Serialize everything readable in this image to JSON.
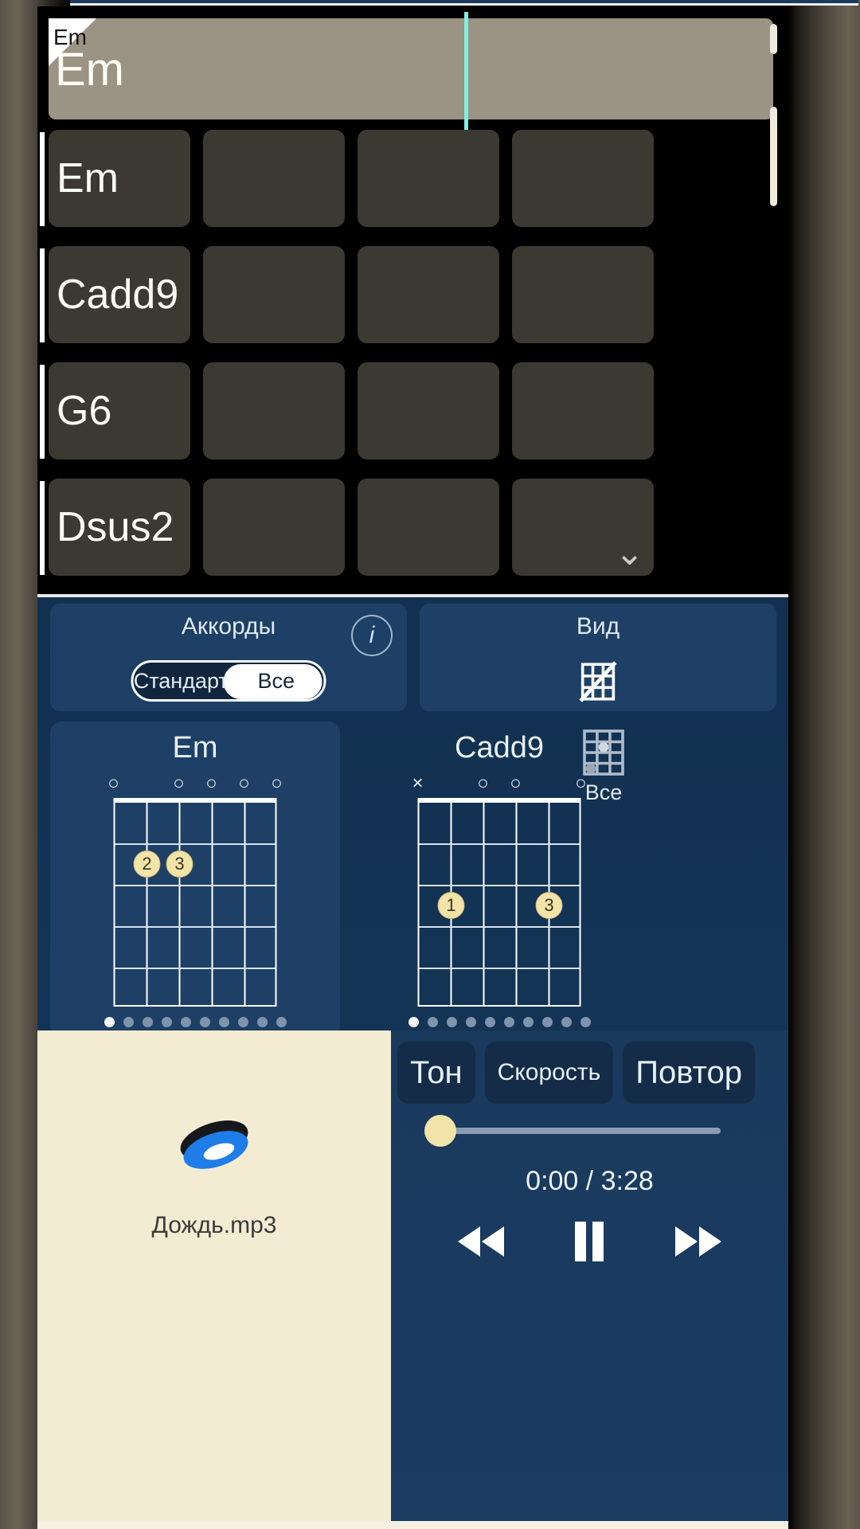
{
  "grid": {
    "timeline": {
      "corner_label": "Em",
      "current_chord": "Em",
      "playhead_label": "playhead"
    },
    "rows": [
      {
        "label": "Em",
        "cells": [
          "Em",
          "",
          "",
          ""
        ]
      },
      {
        "label": "Cadd9",
        "cells": [
          "Cadd9",
          "",
          "",
          ""
        ]
      },
      {
        "label": "G6",
        "cells": [
          "G6",
          "",
          "",
          ""
        ]
      },
      {
        "label": "Dsus2",
        "cells": [
          "Dsus2",
          "",
          "",
          ""
        ]
      }
    ],
    "expand_icon": "chevron-down-icon"
  },
  "options": {
    "chords": {
      "title": "Аккорды",
      "info_label": "i",
      "segments": [
        "Стандарт",
        "Все"
      ],
      "selected": "Все"
    },
    "view": {
      "title": "Вид",
      "icon": "grid-off-icon"
    }
  },
  "diagrams": [
    {
      "name": "Em",
      "markers": [
        "o",
        "",
        "o",
        "o",
        "o",
        ""
      ],
      "string_marks": [
        {
          "string": 1,
          "symbol": "o"
        },
        {
          "string": 3,
          "symbol": "o"
        },
        {
          "string": 4,
          "symbol": "o"
        },
        {
          "string": 5,
          "symbol": "o"
        }
      ],
      "fingers": [
        {
          "string": 2,
          "fret": 2,
          "finger": "2"
        },
        {
          "string": 3,
          "fret": 2,
          "finger": "3"
        }
      ],
      "frets": 5,
      "pages": 10,
      "active_page": 0
    },
    {
      "name": "Cadd9",
      "string_marks": [
        {
          "string": 1,
          "symbol": "×"
        },
        {
          "string": 3,
          "symbol": "o"
        },
        {
          "string": 4,
          "symbol": "o"
        },
        {
          "string": 6,
          "symbol": "o"
        }
      ],
      "fingers": [
        {
          "string": 2,
          "fret": 3,
          "finger": "1"
        },
        {
          "string": 5,
          "fret": 3,
          "finger": "3"
        }
      ],
      "frets": 5,
      "pages": 10,
      "active_page": 0
    }
  ],
  "all_button": {
    "label": "Все",
    "icon": "chord-grid-icon"
  },
  "player": {
    "track_name": "Дождь.mp3",
    "album_icon": "disc-icon",
    "buttons": [
      {
        "label": "Тон",
        "size": "big"
      },
      {
        "label": "Скорость",
        "size": "small"
      },
      {
        "label": "Повтор",
        "size": "big"
      }
    ],
    "progress_percent": 0,
    "time": "0:00 / 3:28",
    "transport": [
      {
        "name": "rewind-button",
        "icon": "rewind-icon"
      },
      {
        "name": "pause-button",
        "icon": "pause-icon"
      },
      {
        "name": "forward-button",
        "icon": "forward-icon"
      }
    ]
  },
  "colors": {
    "accent_blue": "#1e4066",
    "panel_blue": "#143557",
    "playhead": "#7ef0e0",
    "dot": "#f2e3a8",
    "timeline": "#9b9384",
    "cell": "#3c3932"
  }
}
